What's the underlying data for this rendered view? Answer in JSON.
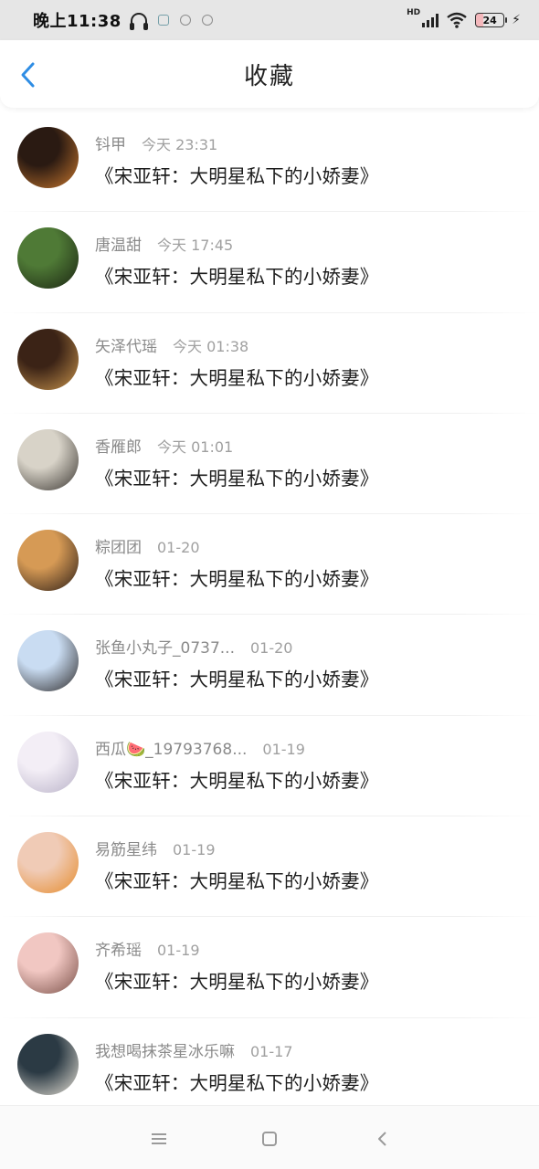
{
  "status_bar": {
    "time": "晚上11:38",
    "battery": "24",
    "network_label": "HD",
    "icons": [
      "headphones-icon",
      "app-notification-icon",
      "cat-notification-icon",
      "cat-notification-icon",
      "signal-icon",
      "wifi-icon",
      "battery-icon",
      "charging-icon"
    ]
  },
  "header": {
    "title": "收藏",
    "back_icon": "chevron-left-icon",
    "accent_color": "#2f8de4"
  },
  "items": [
    {
      "name": "钭甲",
      "time": "今天 23:31",
      "book": "《宋亚轩：大明星私下的小娇妻》",
      "avatar_colors": [
        "#2a1a12",
        "#c9782e"
      ]
    },
    {
      "name": "唐温甜",
      "time": "今天 17:45",
      "book": "《宋亚轩：大明星私下的小娇妻》",
      "avatar_colors": [
        "#4f7a36",
        "#1a2412"
      ]
    },
    {
      "name": "矢泽代瑶",
      "time": "今天 01:38",
      "book": "《宋亚轩：大明星私下的小娇妻》",
      "avatar_colors": [
        "#3b2316",
        "#c8944c"
      ]
    },
    {
      "name": "香雁郎",
      "time": "今天 01:01",
      "book": "《宋亚轩：大明星私下的小娇妻》",
      "avatar_colors": [
        "#d8d3c8",
        "#3a3631"
      ]
    },
    {
      "name": "粽团团",
      "time": "01-20",
      "book": "《宋亚轩：大明星私下的小娇妻》",
      "avatar_colors": [
        "#d69a55",
        "#2b1d16"
      ]
    },
    {
      "name": "张鱼小丸子_0737...",
      "time": "01-20",
      "book": "《宋亚轩：大明星私下的小娇妻》",
      "avatar_colors": [
        "#c9dcf2",
        "#2d2a2a"
      ]
    },
    {
      "name": "西瓜🍉_19793768...",
      "time": "01-19",
      "book": "《宋亚轩：大明星私下的小娇妻》",
      "avatar_colors": [
        "#f3eef6",
        "#b9b2c8"
      ]
    },
    {
      "name": "易筋星纬",
      "time": "01-19",
      "book": "《宋亚轩：大明星私下的小娇妻》",
      "avatar_colors": [
        "#f0cbb6",
        "#e58b2c"
      ]
    },
    {
      "name": "齐希瑶",
      "time": "01-19",
      "book": "《宋亚轩：大明星私下的小娇妻》",
      "avatar_colors": [
        "#f1c7c2",
        "#7a5048"
      ]
    },
    {
      "name": "我想喝抹茶星冰乐嘛",
      "time": "01-17",
      "book": "《宋亚轩：大明星私下的小娇妻》",
      "avatar_colors": [
        "#2b3a44",
        "#e7e1d6"
      ]
    }
  ],
  "nav_bar": {
    "icons": [
      "menu-icon",
      "home-square-icon",
      "back-triangle-icon"
    ]
  }
}
